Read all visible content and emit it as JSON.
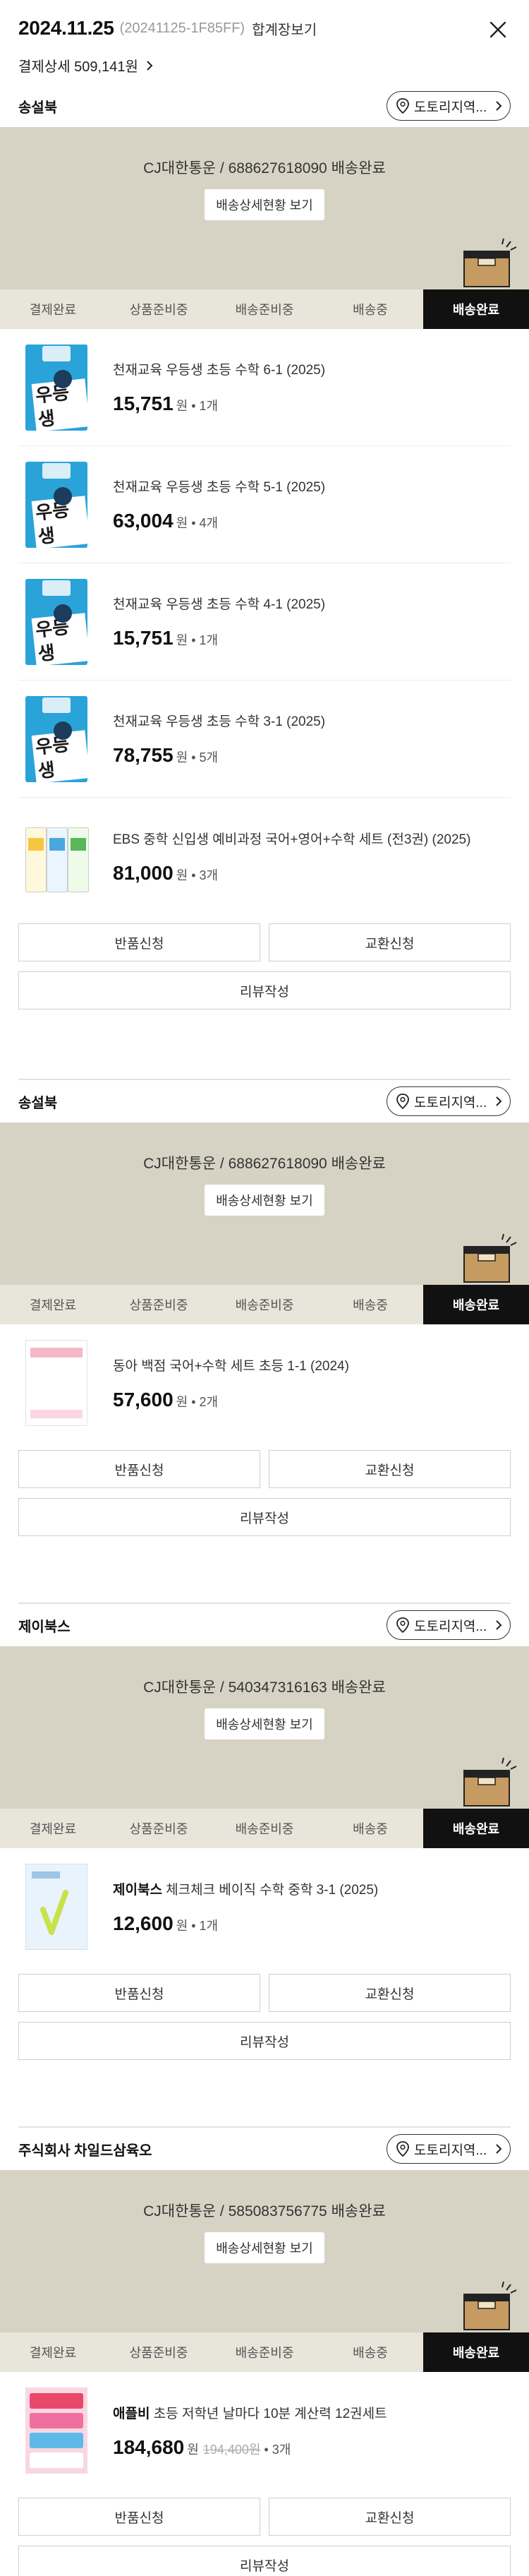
{
  "header": {
    "date": "2024.11.25",
    "order_no": "(20241125-1F85FF)",
    "combined_label": "합계장보기",
    "payment_label": "결제상세 509,141원"
  },
  "steps": [
    "결제완료",
    "상품준비중",
    "배송준비중",
    "배송중",
    "배송완료"
  ],
  "location_button_label": "도토리지역...",
  "detail_button_label": "배송상세현황 보기",
  "actions": {
    "return": "반품신청",
    "exchange": "교환신청",
    "review": "리뷰작성"
  },
  "colors": {
    "banner": "#d7d3c4",
    "active_step": "#111111",
    "accent_pink": "#d6244f"
  },
  "sections": [
    {
      "seller": "송설북",
      "carrier": "CJ대한통운 / 688627618090 배송완료",
      "active_step": "배송완료",
      "items": [
        {
          "thumb": "book-cyan",
          "grade": "6",
          "thumb_title": "우등생",
          "name": "천재교육 우등생 초등 수학 6-1 (2025)",
          "price": "15,751",
          "won": "원",
          "qty": "1개"
        },
        {
          "thumb": "book-cyan",
          "grade": "5",
          "thumb_title": "우등생",
          "name": "천재교육 우등생 초등 수학 5-1 (2025)",
          "price": "63,004",
          "won": "원",
          "qty": "4개"
        },
        {
          "thumb": "book-cyan",
          "grade": "4",
          "thumb_title": "우등생",
          "name": "천재교육 우등생 초등 수학 4-1 (2025)",
          "price": "15,751",
          "won": "원",
          "qty": "1개"
        },
        {
          "thumb": "book-cyan",
          "grade": "3",
          "thumb_title": "우등생",
          "name": "천재교육 우등생 초등 수학 3-1 (2025)",
          "price": "78,755",
          "won": "원",
          "qty": "5개"
        },
        {
          "thumb": "set3",
          "name": "EBS 중학 신입생 예비과정 국어+영어+수학 세트 (전3권) (2025)",
          "price": "81,000",
          "won": "원",
          "qty": "3개"
        }
      ]
    },
    {
      "seller": "송설북",
      "carrier": "CJ대한통운 / 688627618090 배송완료",
      "active_step": "배송완료",
      "items": [
        {
          "thumb": "dong",
          "name": "동아 백점 국어+수학 세트 초등 1-1 (2024)",
          "price": "57,600",
          "won": "원",
          "qty": "2개"
        }
      ]
    },
    {
      "seller": "제이북스",
      "carrier": "CJ대한통운 / 540347316163 배송완료",
      "active_step": "배송완료",
      "items": [
        {
          "thumb": "check",
          "brand": "제이북스",
          "name": "체크체크 베이직 수학 중학 3-1 (2025)",
          "price": "12,600",
          "won": "원",
          "qty": "1개"
        }
      ]
    },
    {
      "seller": "주식회사 차일드삼육오",
      "carrier": "CJ대한통운 / 585083756775 배송완료",
      "active_step": "배송완료",
      "items": [
        {
          "thumb": "apple",
          "brand": "애플비",
          "name": "애플비 초등 저학년 날마다 10분 계산력 12권세트",
          "price": "184,680",
          "won": "원",
          "orig_price": "194,400원",
          "qty": "3개"
        }
      ]
    }
  ]
}
